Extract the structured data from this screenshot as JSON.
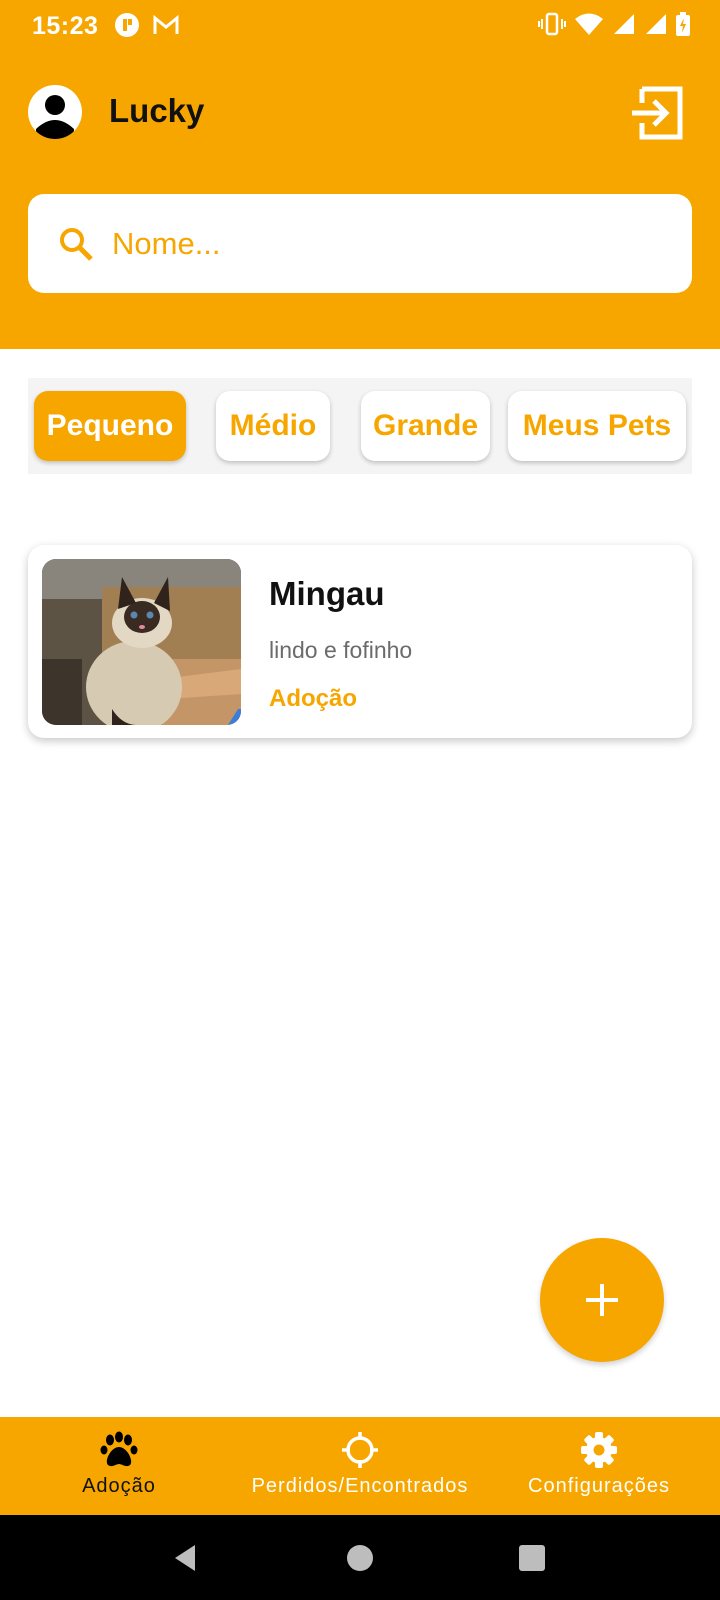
{
  "status_bar": {
    "time": "15:23"
  },
  "header": {
    "user_name": "Lucky"
  },
  "search": {
    "placeholder": "Nome..."
  },
  "filters": [
    {
      "label": "Pequeno",
      "active": true
    },
    {
      "label": "Médio",
      "active": false
    },
    {
      "label": "Grande",
      "active": false
    },
    {
      "label": "Meus Pets",
      "active": false
    }
  ],
  "pets": [
    {
      "name": "Mingau",
      "description": "lindo e fofinho",
      "status": "Adoção"
    }
  ],
  "bottom_nav": [
    {
      "label": "Adoção",
      "icon": "paw-icon",
      "active": true
    },
    {
      "label": "Perdidos/Encontrados",
      "icon": "crosshair-icon",
      "active": false
    },
    {
      "label": "Configurações",
      "icon": "gear-icon",
      "active": false
    }
  ],
  "colors": {
    "accent": "#F7A600",
    "white": "#FFFFFF",
    "text": "#111111"
  }
}
